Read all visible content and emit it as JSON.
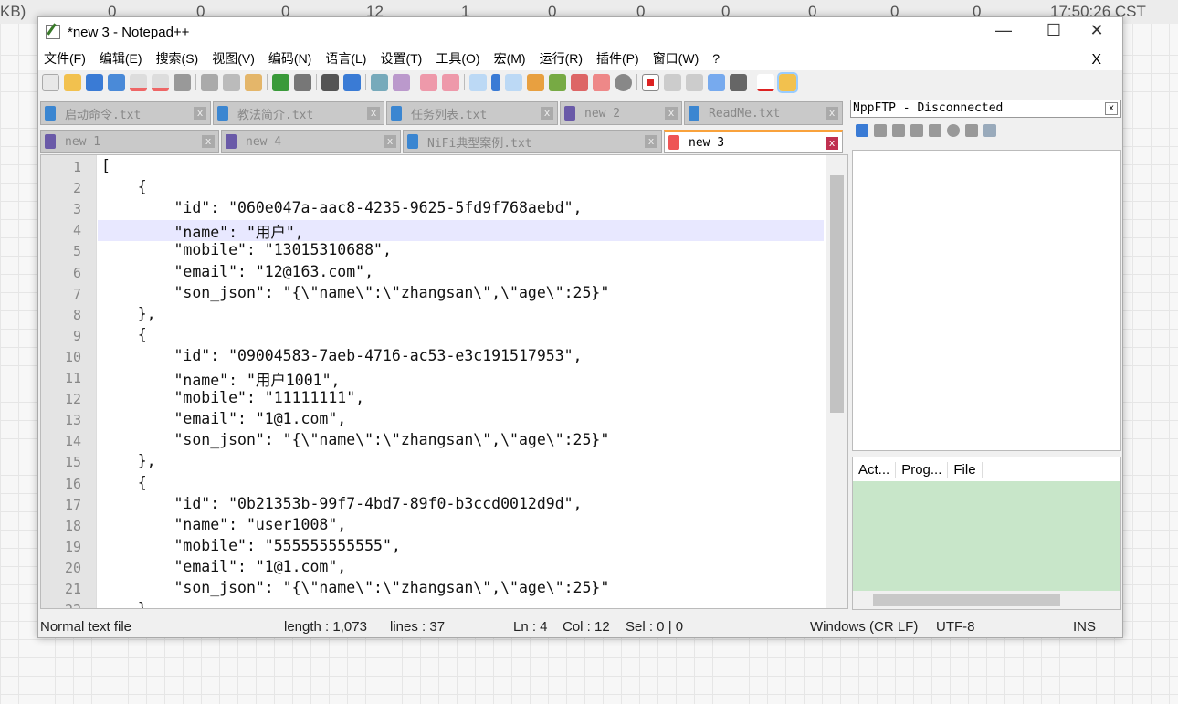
{
  "desktop_bar": {
    "size_fragment": "KB)",
    "counters": [
      "0",
      "0",
      "0",
      "12",
      "1",
      "0",
      "0",
      "0",
      "0",
      "0",
      "0"
    ],
    "time": "17:50:26 CST"
  },
  "window": {
    "title": "*new 3 - Notepad++",
    "minimize": "—",
    "maximize": "☐",
    "close": "✕"
  },
  "menu": [
    "文件(F)",
    "编辑(E)",
    "搜索(S)",
    "视图(V)",
    "编码(N)",
    "语言(L)",
    "设置(T)",
    "工具(O)",
    "宏(M)",
    "运行(R)",
    "插件(P)",
    "窗口(W)",
    "?"
  ],
  "menu_close": "X",
  "tabs_row1": [
    "启动命令.txt",
    "教法简介.txt",
    "任务列表.txt",
    "new 2",
    "ReadMe.txt"
  ],
  "tabs_row2": [
    "new 1",
    "new 4",
    "NiFi典型案例.txt",
    "new 3"
  ],
  "active_tab": "new 3",
  "editor": {
    "current_line": 4,
    "lines": [
      "[",
      "    {",
      "        \"id\": \"060e047a-aac8-4235-9625-5fd9f768aebd\",",
      "        \"name\": \"用户\",",
      "        \"mobile\": \"13015310688\",",
      "        \"email\": \"12@163.com\",",
      "        \"son_json\": \"{\\\"name\\\":\\\"zhangsan\\\",\\\"age\\\":25}\"",
      "    },",
      "    {",
      "        \"id\": \"09004583-7aeb-4716-ac53-e3c191517953\",",
      "        \"name\": \"用户1001\",",
      "        \"mobile\": \"11111111\",",
      "        \"email\": \"1@1.com\",",
      "        \"son_json\": \"{\\\"name\\\":\\\"zhangsan\\\",\\\"age\\\":25}\"",
      "    },",
      "    {",
      "        \"id\": \"0b21353b-99f7-4bd7-89f0-b3ccd0012d9d\",",
      "        \"name\": \"user1008\",",
      "        \"mobile\": \"555555555555\",",
      "        \"email\": \"1@1.com\",",
      "        \"son_json\": \"{\\\"name\\\":\\\"zhangsan\\\",\\\"age\\\":25}\"",
      "    }"
    ]
  },
  "ftp": {
    "title": "NppFTP - Disconnected",
    "close": "x",
    "columns": [
      "Act...",
      "Prog...",
      "File"
    ]
  },
  "status": {
    "type": "Normal text file",
    "length": "length : 1,073",
    "lines": "lines : 37",
    "ln": "Ln : 4",
    "col": "Col : 12",
    "sel": "Sel : 0 | 0",
    "eol": "Windows (CR LF)",
    "enc": "UTF-8",
    "mode": "INS"
  }
}
